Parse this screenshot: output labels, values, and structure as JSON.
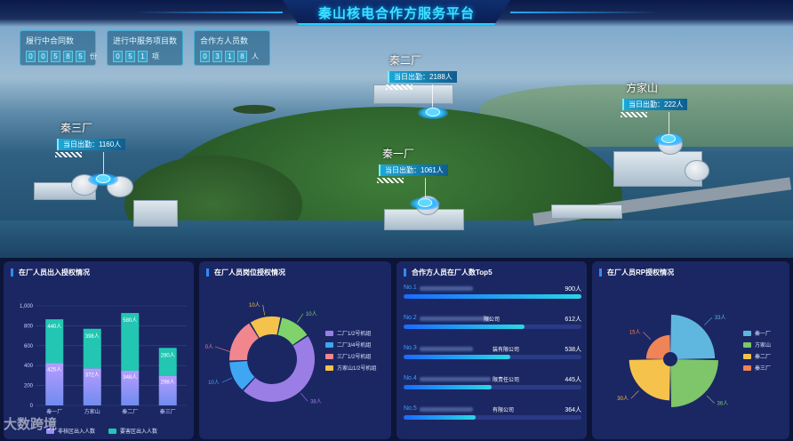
{
  "header": {
    "title": "秦山核电合作方服务平台"
  },
  "stats": [
    {
      "label": "履行中合同数",
      "digits": [
        "0",
        "0",
        "5",
        "8",
        "5"
      ],
      "unit": "份"
    },
    {
      "label": "进行中服务项目数",
      "digits": [
        "0",
        "5",
        "1"
      ],
      "unit": "项"
    },
    {
      "label": "合作方人员数",
      "digits": [
        "0",
        "3",
        "1",
        "8"
      ],
      "unit": "人"
    }
  ],
  "markers": [
    {
      "name": "秦二厂",
      "badge": "当日出勤：2188人"
    },
    {
      "name": "方家山",
      "badge": "当日出勤：222人"
    },
    {
      "name": "秦三厂",
      "badge": "当日出勤：1160人"
    },
    {
      "name": "秦一厂",
      "badge": "当日出勤：1061人"
    }
  ],
  "panels": {
    "access": {
      "title": "在厂人员出入授权情况"
    },
    "post": {
      "title": "在厂人员岗位授权情况"
    },
    "top5": {
      "title": "合作方人员在厂人数Top5"
    },
    "rp": {
      "title": "在厂人员RP授权情况"
    }
  },
  "colors": {
    "accent": "#3ee0ff",
    "panel_bg": "#1b2763",
    "bar_low": "#9b8cff",
    "bar_high": "#23c6b2"
  },
  "chart_data": [
    {
      "type": "bar",
      "title": "在厂人员出入授权情况",
      "categories": [
        "秦一厂",
        "方家山",
        "秦二厂",
        "秦三厂"
      ],
      "series": [
        {
          "name": "非核区出入人数",
          "values": [
            425,
            372,
            348,
            298
          ]
        },
        {
          "name": "要害区出入人数",
          "values": [
            440,
            398,
            580,
            280
          ]
        }
      ],
      "ylim": [
        0,
        1000
      ],
      "yticks": [
        "0",
        "200",
        "400",
        "600",
        "800",
        "1,000"
      ],
      "data_labels_low": [
        "425人",
        "372人",
        "348人",
        "298人"
      ],
      "data_labels_high": [
        "440人",
        "398人",
        "580人",
        "280人"
      ],
      "stacked": true,
      "legend": "bottom"
    },
    {
      "type": "pie",
      "title": "在厂人员岗位授权情况",
      "labels": [
        "二厂1/2号机组",
        "二厂3/4号机组",
        "三厂1/2号机组",
        "方家山1/2号机组"
      ],
      "values": [
        38,
        10,
        0,
        10
      ],
      "colors": [
        "#9a7ee6",
        "#3ea6f2",
        "#f2868f",
        "#f5c24b"
      ],
      "data_labels": [
        "38人",
        "10人",
        "0人",
        "10人"
      ],
      "extra_slices": [
        {
          "value": 10,
          "color": "#7fd36a",
          "label": "10人"
        }
      ],
      "legend": "right",
      "donut": true
    },
    {
      "type": "bar",
      "title": "合作方人员在厂人数Top5",
      "orientation": "horizontal",
      "categories": [
        "No.1",
        "No.2",
        "No.3",
        "No.4",
        "No.5"
      ],
      "names": [
        "",
        "限公司",
        "装有限公司",
        "限责任公司",
        "有限公司"
      ],
      "values": [
        900,
        612,
        538,
        445,
        364
      ],
      "data_labels": [
        "900人",
        "612人",
        "538人",
        "445人",
        "364人"
      ],
      "xlim": [
        0,
        900
      ]
    },
    {
      "type": "pie",
      "title": "在厂人员RP授权情况",
      "labels": [
        "秦一厂",
        "方家山",
        "秦二厂",
        "秦三厂"
      ],
      "values": [
        33,
        36,
        30,
        15
      ],
      "colors": [
        "#5fb7e0",
        "#7fc56a",
        "#f5c24b",
        "#f08456"
      ],
      "data_labels": [
        "33人",
        "36人",
        "30人",
        "15人"
      ],
      "rose": true,
      "legend": "right"
    }
  ],
  "watermark": "大数跨境"
}
